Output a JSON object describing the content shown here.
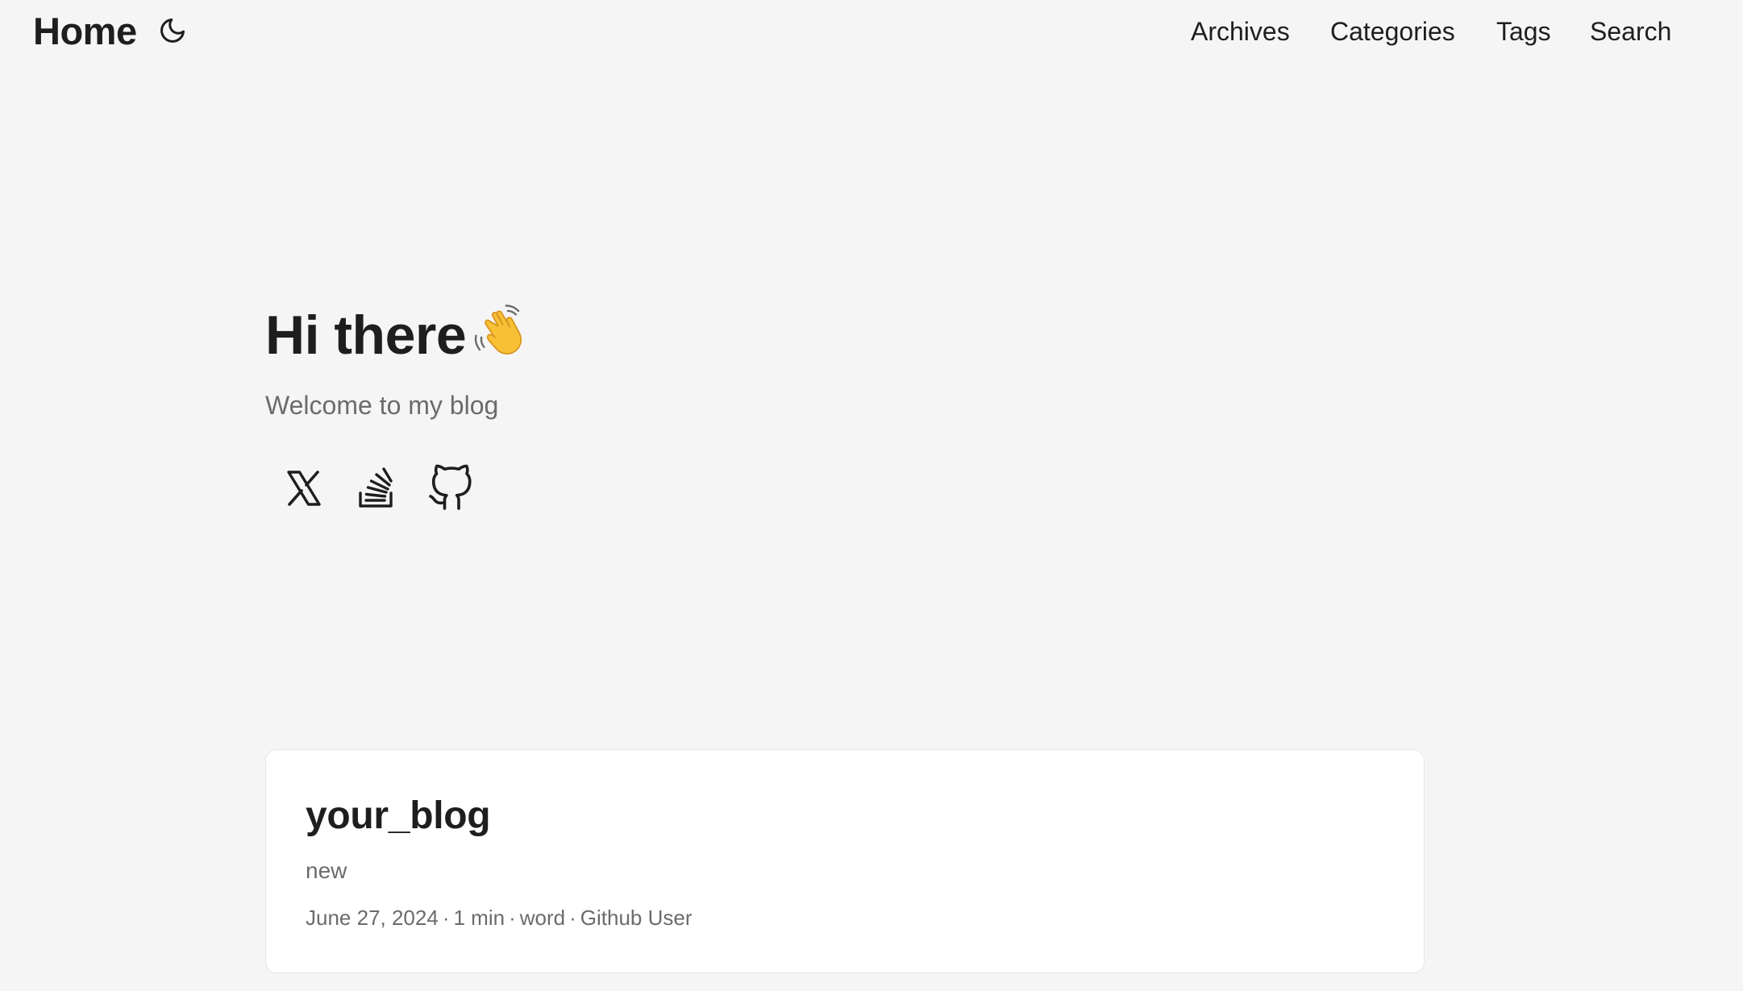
{
  "header": {
    "logo": "Home",
    "theme_toggle_icon": "moon-icon",
    "nav": [
      "Archives",
      "Categories",
      "Tags",
      "Search"
    ]
  },
  "hero": {
    "title": "Hi there",
    "title_icon": "waving-hand-icon",
    "subtitle": "Welcome to my blog",
    "social": [
      {
        "icon": "x-twitter-icon"
      },
      {
        "icon": "stackoverflow-icon"
      },
      {
        "icon": "github-icon"
      }
    ]
  },
  "posts": [
    {
      "title": "your_blog",
      "summary": "new",
      "date": "June 27, 2024",
      "reading_time": "1 min",
      "words": "word",
      "author": "Github User",
      "separator": "·"
    }
  ],
  "colors": {
    "background": "#f5f5f5",
    "text": "#1e1e1e",
    "secondary_text": "#6b6b6b",
    "card_background": "#ffffff",
    "card_border": "#e6e6e6"
  }
}
